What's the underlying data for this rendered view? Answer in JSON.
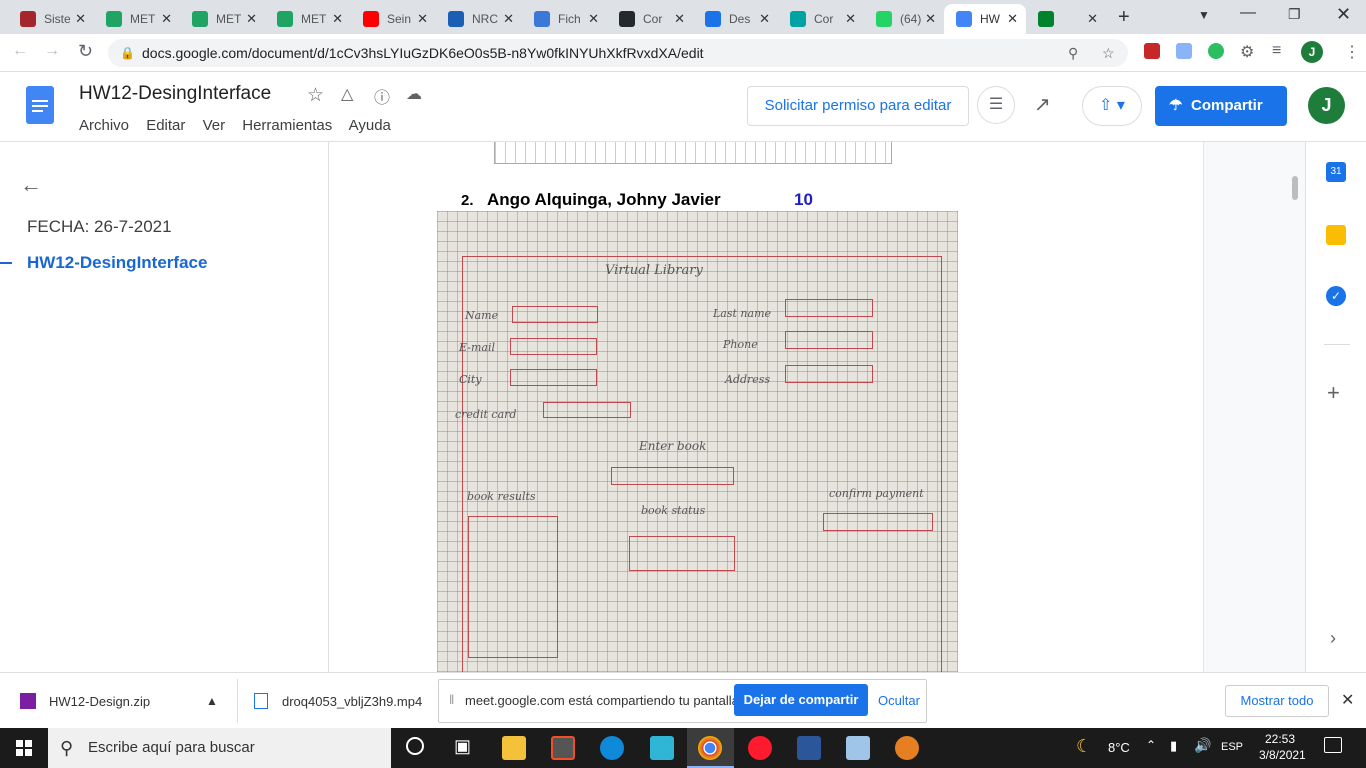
{
  "browser": {
    "tabs": [
      {
        "label": "Siste",
        "color": "#a4262c"
      },
      {
        "label": "MET",
        "color": "#1fa463"
      },
      {
        "label": "MET",
        "color": "#1fa463"
      },
      {
        "label": "MET",
        "color": "#1fa463"
      },
      {
        "label": "Sein",
        "color": "#ff0000"
      },
      {
        "label": "NRC",
        "color": "#1a5fb4"
      },
      {
        "label": "Fich",
        "color": "#3c78d8"
      },
      {
        "label": "Cor",
        "color": "#24292e"
      },
      {
        "label": "Des",
        "color": "#1a73e8"
      },
      {
        "label": "Cor",
        "color": "#00a3a3"
      },
      {
        "label": "(64)",
        "color": "#25d366"
      },
      {
        "label": "HW",
        "color": "#4285f4"
      },
      {
        "label": "",
        "color": "#00832d"
      }
    ],
    "url": "docs.google.com/document/d/1cCv3hsLYIuGzDK6eO0s5B-n8Yw0fkINYUhXkfRvxdXA/edit"
  },
  "docs": {
    "title": "HW12-DesingInterface",
    "menu": [
      "Archivo",
      "Editar",
      "Ver",
      "Herramientas",
      "Ayuda"
    ],
    "request_edit": "Solicitar permiso para editar",
    "share": "Compartir",
    "avatar_letter": "J"
  },
  "outline": {
    "items": [
      "FECHA: 26-7-2021",
      "HW12-DesingInterface"
    ]
  },
  "document": {
    "list_number": "2.",
    "student_name": "Ango Alquinga, Johny Javier",
    "grade": "10",
    "sketch": {
      "title": "Virtual Library",
      "labels": [
        "Name",
        "E-mail",
        "City",
        "Last name",
        "Phone",
        "Address",
        "credit card",
        "Enter book",
        "book results",
        "book status",
        "confirm payment"
      ]
    }
  },
  "downloads": {
    "file1": "HW12-Design.zip",
    "file2": "droq4053_vbljZ3h9.mp4",
    "sharing_msg": "meet.google.com está compartiendo tu pantalla.",
    "stop_sharing": "Dejar de compartir",
    "hide": "Ocultar",
    "show_all": "Mostrar todo"
  },
  "taskbar": {
    "search_placeholder": "Escribe aquí para buscar",
    "temperature": "8°C",
    "language": "ESP",
    "time": "22:53",
    "date": "3/8/2021"
  }
}
